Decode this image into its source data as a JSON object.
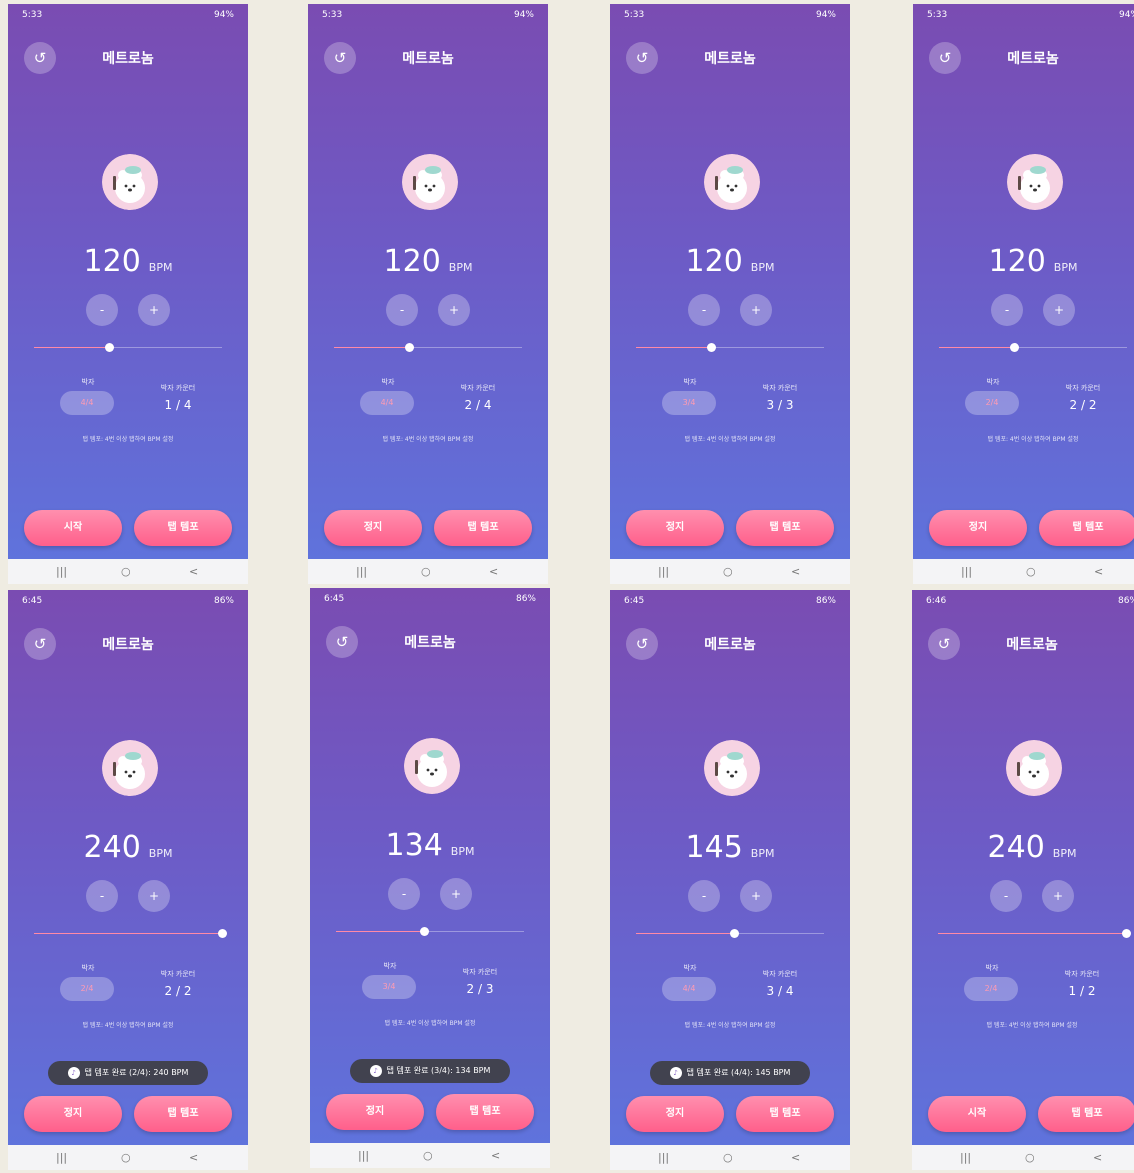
{
  "app": {
    "title": "메트로놈",
    "unit": "BPM",
    "minus": "-",
    "plus": "+",
    "beat_label": "박자",
    "counter_label": "박자 카운터",
    "hint": "탭 템포: 4번 이상 탭하여 BPM 설정",
    "tap_tempo_label": "탭 템포",
    "back_icon": "↺"
  },
  "colors": {
    "gradient_top": "#7a4cb2",
    "gradient_bottom": "#5f73dc",
    "button_pink": "#ff6f96",
    "slider_fill": "#ff8aa6"
  },
  "nav": {
    "recent": "|||",
    "home": "○",
    "back": "<"
  },
  "screens": [
    {
      "time": "5:33",
      "sys": "94%",
      "bpm": "120",
      "beat": "4/4",
      "counter": "1 / 4",
      "primary": "시작",
      "slider": 0.4,
      "toast": ""
    },
    {
      "time": "5:33",
      "sys": "94%",
      "bpm": "120",
      "beat": "4/4",
      "counter": "2 / 4",
      "primary": "정지",
      "slider": 0.4,
      "toast": ""
    },
    {
      "time": "5:33",
      "sys": "94%",
      "bpm": "120",
      "beat": "3/4",
      "counter": "3 / 3",
      "primary": "정지",
      "slider": 0.4,
      "toast": ""
    },
    {
      "time": "5:33",
      "sys": "94%",
      "bpm": "120",
      "beat": "2/4",
      "counter": "2 / 2",
      "primary": "정지",
      "slider": 0.4,
      "toast": ""
    },
    {
      "time": "6:45",
      "sys": "86%",
      "bpm": "240",
      "beat": "2/4",
      "counter": "2 / 2",
      "primary": "정지",
      "slider": 1.0,
      "toast": "탭 템포 완료 (2/4): 240 BPM"
    },
    {
      "time": "6:45",
      "sys": "86%",
      "bpm": "134",
      "beat": "3/4",
      "counter": "2 / 3",
      "primary": "정지",
      "slider": 0.47,
      "toast": "탭 템포 완료 (3/4): 134 BPM"
    },
    {
      "time": "6:45",
      "sys": "86%",
      "bpm": "145",
      "beat": "4/4",
      "counter": "3 / 4",
      "primary": "정지",
      "slider": 0.52,
      "toast": "탭 템포 완료 (4/4): 145 BPM"
    },
    {
      "time": "6:46",
      "sys": "86%",
      "bpm": "240",
      "beat": "2/4",
      "counter": "1 / 2",
      "primary": "시작",
      "slider": 1.0,
      "toast": ""
    }
  ]
}
